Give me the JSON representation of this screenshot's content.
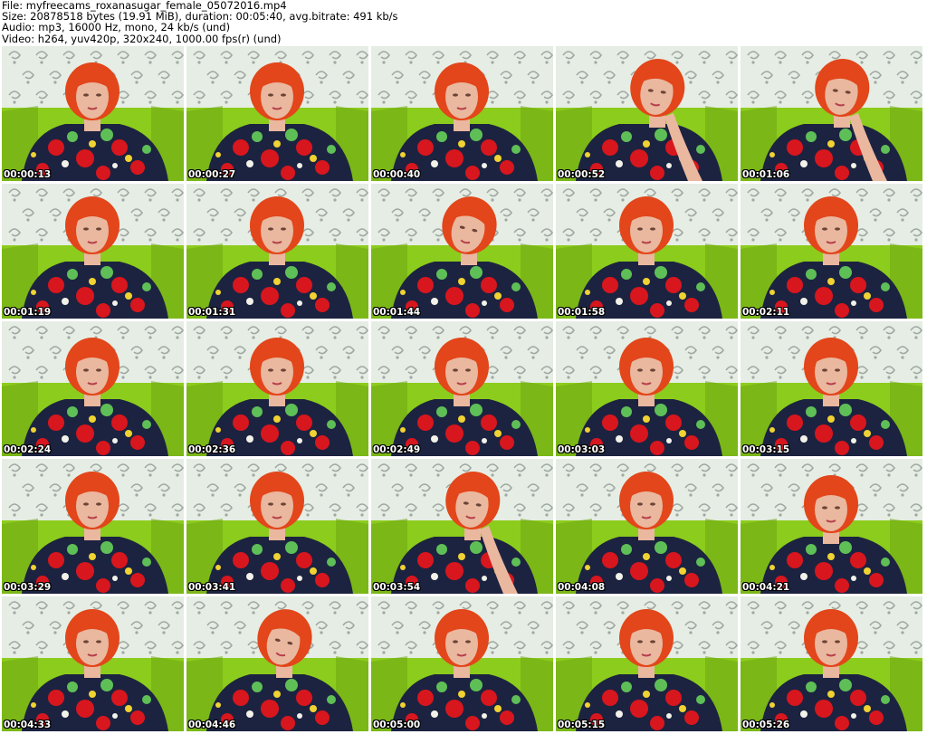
{
  "header": {
    "file_line": "File: myfreecams_roxanasugar_female_05072016.mp4",
    "size_line": "Size: 20878518 bytes (19.91 MiB), duration: 00:05:40, avg.bitrate: 491 kb/s",
    "audio_line": "Audio: mp3, 16000 Hz, mono, 24 kb/s (und)",
    "video_line": "Video: h264, yuv420p, 320x240, 1000.00 fps(r) (und)"
  },
  "thumbnails": [
    {
      "timestamp": "00:00:13",
      "pose": "look-down"
    },
    {
      "timestamp": "00:00:27",
      "pose": "look-down"
    },
    {
      "timestamp": "00:00:40",
      "pose": "look-down"
    },
    {
      "timestamp": "00:00:52",
      "pose": "hand-chin"
    },
    {
      "timestamp": "00:01:06",
      "pose": "hand-chin"
    },
    {
      "timestamp": "00:01:19",
      "pose": "front"
    },
    {
      "timestamp": "00:01:31",
      "pose": "front"
    },
    {
      "timestamp": "00:01:44",
      "pose": "tilt"
    },
    {
      "timestamp": "00:01:58",
      "pose": "front"
    },
    {
      "timestamp": "00:02:11",
      "pose": "front"
    },
    {
      "timestamp": "00:02:24",
      "pose": "look-down"
    },
    {
      "timestamp": "00:02:36",
      "pose": "look-down"
    },
    {
      "timestamp": "00:02:49",
      "pose": "look-down"
    },
    {
      "timestamp": "00:03:03",
      "pose": "look-down"
    },
    {
      "timestamp": "00:03:15",
      "pose": "look-down"
    },
    {
      "timestamp": "00:03:29",
      "pose": "front"
    },
    {
      "timestamp": "00:03:41",
      "pose": "front"
    },
    {
      "timestamp": "00:03:54",
      "pose": "hand-chin"
    },
    {
      "timestamp": "00:04:08",
      "pose": "front"
    },
    {
      "timestamp": "00:04:21",
      "pose": "look-down"
    },
    {
      "timestamp": "00:04:33",
      "pose": "front"
    },
    {
      "timestamp": "00:04:46",
      "pose": "tilt"
    },
    {
      "timestamp": "00:05:00",
      "pose": "front"
    },
    {
      "timestamp": "00:05:15",
      "pose": "front"
    },
    {
      "timestamp": "00:05:26",
      "pose": "front"
    }
  ],
  "colors": {
    "wallpaper": "#e6ede4",
    "wallpaper_swirl": "#9fa8a2",
    "couch": "#8ccc1c",
    "couch_dark": "#6ea614",
    "hair": "#e2461a",
    "skin": "#eab79f",
    "dress": "#1c2340",
    "flower_red": "#d8161e",
    "flower_green": "#5fbf57",
    "flower_yellow": "#f0d232",
    "flower_white": "#f2f2ea"
  }
}
